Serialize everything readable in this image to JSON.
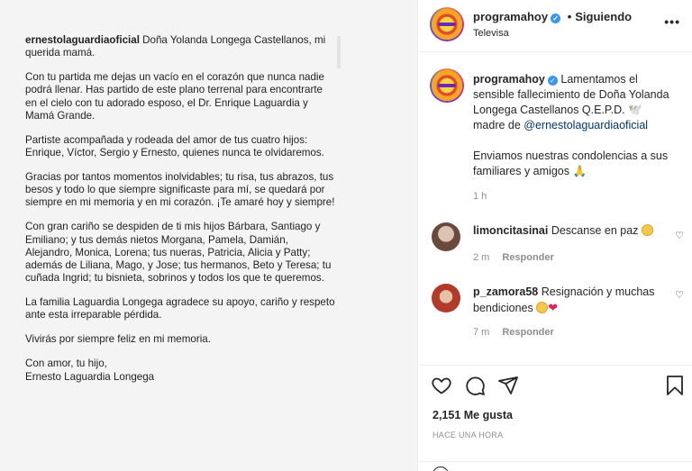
{
  "letter": {
    "author": "ernestolaguardiaoficial",
    "p1_rest": " Doña Yolanda Longega Castellanos, mi querida mamá.",
    "p2": "Con tu partida me dejas un vacío en el corazón que nunca nadie podrá llenar. Has partido de este plano terrenal para encontrarte en el cielo con tu adorado esposo, el Dr. Enrique Laguardia y Mamá Grande.",
    "p3": "Partiste acompañada y rodeada del amor de tus cuatro hijos: Enrique, Víctor, Sergio y Ernesto, quienes nunca te olvidaremos.",
    "p4": "Gracias por tantos momentos inolvidables; tu risa, tus abrazos, tus besos y todo lo que siempre significaste para mí, se quedará por siempre en mi memoria y en mi corazón. ¡Te amaré hoy y siempre!",
    "p5": "Con gran cariño se despiden de ti mis hijos Bárbara, Santiago y Emiliano; y tus demás nietos Morgana, Pamela, Damián, Alejandro, Monica, Lorena; tus nueras, Patricia, Alicia y Patty; además de Liliana, Mago, y Jose; tus hermanos, Beto y Teresa; tu cuñada Ingrid; tu bisnieta, sobrinos y todos los que te queremos.",
    "p6": "La familia Laguardia Longega agradece su apoyo, cariño y respeto ante esta irreparable pérdida.",
    "p7": "Vivirás por siempre feliz en mi memoria.",
    "p8": "Con amor, tu hijo,\nErnesto Laguardia Longega"
  },
  "header": {
    "username": "programahoy",
    "separator": "•",
    "follow_label": "Siguiendo",
    "subtitle": "Televisa",
    "more": "•••"
  },
  "caption": {
    "username": "programahoy",
    "text1": " Lamentamos el sensible fallecimiento de Doña Yolanda Longega Castellanos Q.E.P.D. 🕊️ madre de ",
    "mention": "@ernestolaguardiaoficial",
    "text2": "Enviamos nuestras condolencias a sus familiares y amigos 🙏",
    "time": "1 h"
  },
  "comments": [
    {
      "username": "limoncitasinai",
      "text": " Descanse en paz ",
      "time": "2 m",
      "reply": "Responder"
    },
    {
      "username": "p_zamora58",
      "text": " Resignación y muchas bendiciones ",
      "time": "7 m",
      "reply": "Responder"
    }
  ],
  "actions": {
    "likes": "2,151 Me gusta",
    "ago": "HACE UNA HORA"
  },
  "colors": {
    "verified": "#3897f0",
    "mention": "#00376b",
    "heart": "#e0245e"
  }
}
